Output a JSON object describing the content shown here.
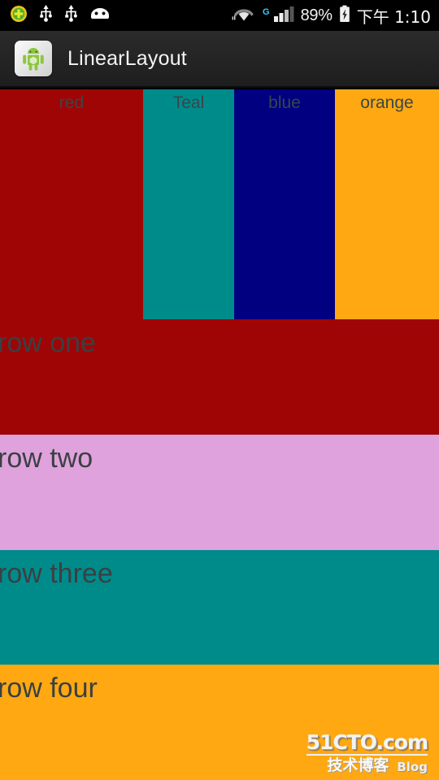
{
  "statusbar": {
    "icons_left": [
      {
        "name": "plus-circle-icon",
        "label": "add"
      },
      {
        "name": "usb-icon",
        "label": "usb"
      },
      {
        "name": "usb-icon",
        "label": "usb"
      },
      {
        "name": "android-head-icon",
        "label": "android"
      }
    ],
    "wifi_icon": "wifi-icon",
    "network_type": "G",
    "signal_icon": "signal-bars-icon",
    "battery_percent": "89%",
    "battery_icon": "battery-charging-icon",
    "clock": "下午 1:10"
  },
  "actionbar": {
    "app_icon": "android-app-icon",
    "title": "LinearLayout"
  },
  "content": {
    "columns": [
      {
        "label": "red",
        "color": "#a00505"
      },
      {
        "label": "Teal",
        "color": "#008b8b"
      },
      {
        "label": "blue",
        "color": "#000080"
      },
      {
        "label": "orange",
        "color": "#ffa812"
      }
    ],
    "rows": [
      {
        "label": "row one",
        "color": "#a00505"
      },
      {
        "label": "row two",
        "color": "#dfa2dc"
      },
      {
        "label": "row three",
        "color": "#008b8b"
      },
      {
        "label": "row four",
        "color": "#ffa812"
      }
    ]
  },
  "watermark": {
    "site": "51CTO.com",
    "subtitle": "技术博客",
    "blog": "Blog"
  }
}
